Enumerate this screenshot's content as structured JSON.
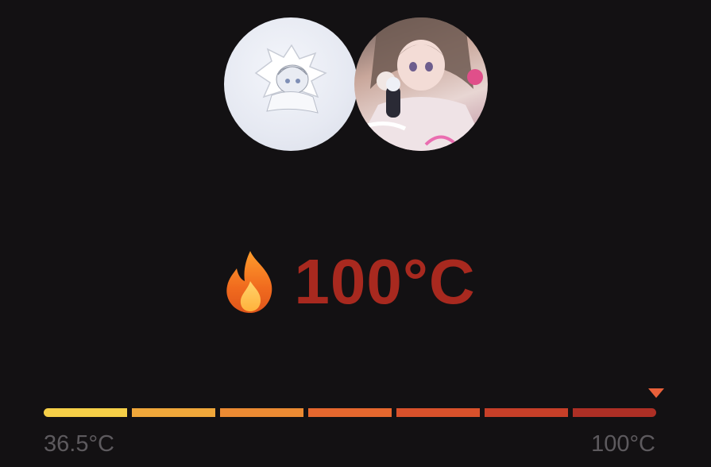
{
  "avatars": [
    {
      "name": "user-avatar-left"
    },
    {
      "name": "user-avatar-right"
    }
  ],
  "temperature": {
    "icon": "fire-icon",
    "value": "100°C",
    "level_fraction": 1.0
  },
  "scale": {
    "min_label": "36.5°C",
    "max_label": "100°C",
    "segment_colors": [
      "#f5cf48",
      "#f0a73a",
      "#eb8a33",
      "#e5672e",
      "#d8512b",
      "#c63f28",
      "#ad2f25"
    ]
  }
}
